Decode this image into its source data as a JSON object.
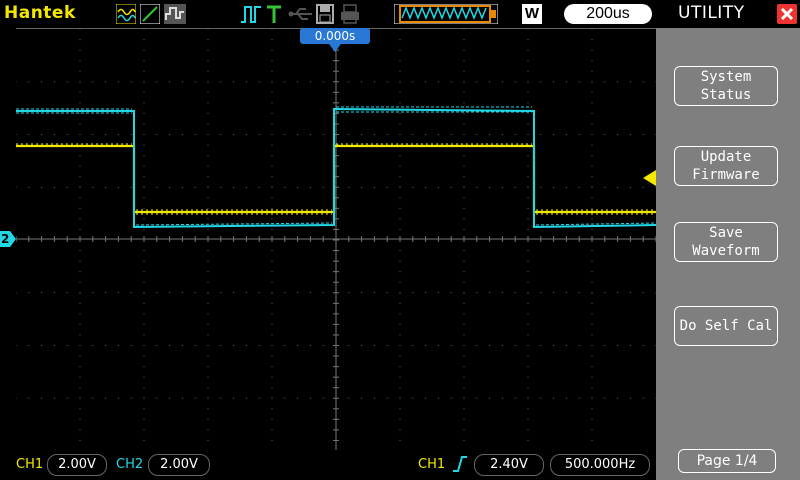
{
  "header": {
    "brand": "Hantek",
    "run_mode_label": "W",
    "timebase": "200us",
    "trigger_position": "0.000s",
    "icons": [
      "waveform-icon",
      "ramp-icon",
      "persist-icon",
      "pulse-icon",
      "trigger-t-icon",
      "usb-icon",
      "save-icon",
      "print-icon",
      "memory-waveform-icon"
    ]
  },
  "status": {
    "ch1_label": "CH1",
    "ch1_scale": "2.00V",
    "ch2_label": "CH2",
    "ch2_scale": "2.00V",
    "trig_source_label": "CH1",
    "trig_level": "2.40V",
    "frequency": "500.000Hz"
  },
  "panel": {
    "title": "UTILITY",
    "buttons": [
      {
        "line1": "System",
        "line2": "Status"
      },
      {
        "line1": "Update",
        "line2": "Firmware"
      },
      {
        "line1": "Save",
        "line2": "Waveform"
      },
      {
        "line1": "Do Self Cal",
        "line2": ""
      }
    ],
    "page_label": "Page 1/4"
  },
  "markers": {
    "ch2_marker_label": "2"
  },
  "colors": {
    "ch1": "#f2e800",
    "ch2": "#22d8e6",
    "trigger_box": "#2a78d6",
    "panel_bg": "#7f7f7f",
    "close": "#e33333"
  }
}
